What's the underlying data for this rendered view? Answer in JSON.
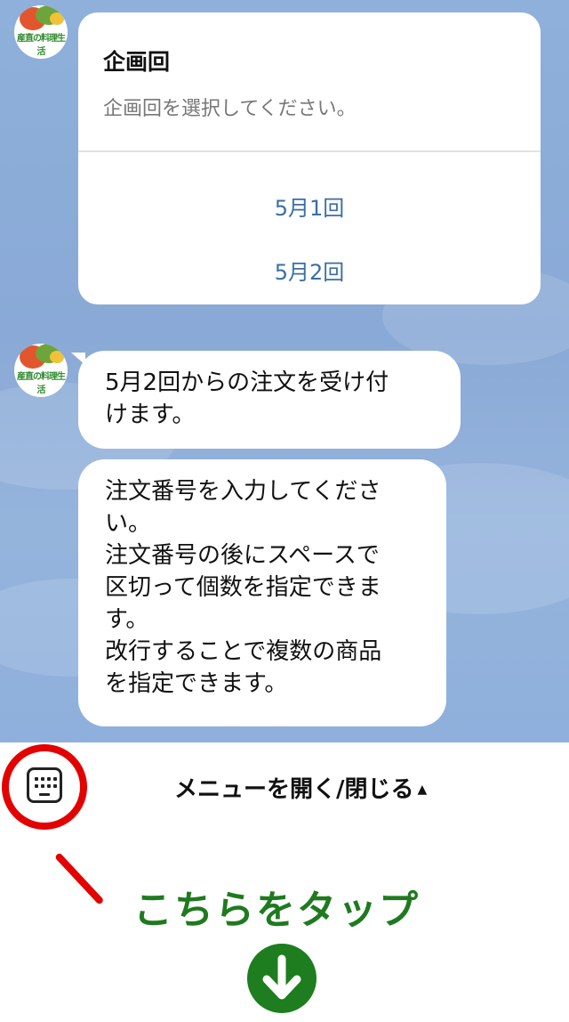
{
  "card": {
    "title": "企画回",
    "subtitle": "企画回を選択してください。",
    "options": [
      "5月1回",
      "5月2回"
    ]
  },
  "messages": [
    {
      "lines": [
        "5月2回からの注文を受け付",
        "けます。"
      ]
    },
    {
      "lines": [
        "注文番号を入力してくださ",
        "い。",
        "注文番号の後にスペースで",
        "区切って個数を指定できま",
        "す。",
        "改行することで複数の商品",
        "を指定できます。"
      ]
    }
  ],
  "avatar": {
    "logo_text": "産直の料理生活"
  },
  "menu": {
    "toggle_label": "メニューを開く/閉じる",
    "toggle_indicator": "▲",
    "keyboard_icon": "keyboard-icon"
  },
  "annotation": {
    "tap_text": "こちらをタップ",
    "arrow_icon": "arrow-down-circle-icon",
    "highlight_color": "#e30000",
    "accent_color": "#1e7d1e"
  }
}
